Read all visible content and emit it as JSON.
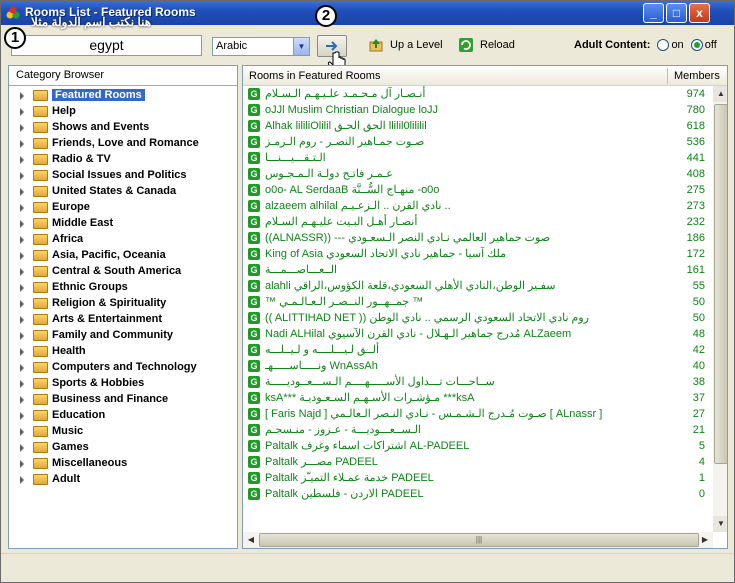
{
  "title": "Rooms List - Featured Rooms",
  "titlebar_buttons": [
    "_",
    "□",
    "x"
  ],
  "annotations": {
    "badge1": "1",
    "badge2": "2",
    "overlay_arabic": "هنا نكتب اسم الدولة مثلا"
  },
  "search": {
    "value": "egypt"
  },
  "language_select": {
    "value": "Arabic"
  },
  "toolbar": {
    "up_level": "Up a Level",
    "reload": "Reload",
    "adult_label": "Adult Content:",
    "on": "on",
    "off": "off",
    "adult_selected": "off"
  },
  "left_pane": {
    "header": "Category Browser",
    "items": [
      "Featured Rooms",
      "Help",
      "Shows and Events",
      "Friends, Love and Romance",
      "Radio & TV",
      "Social Issues and Politics",
      "United States & Canada",
      "Europe",
      "Middle East",
      "Africa",
      "Asia, Pacific, Oceania",
      "Central & South America",
      "Ethnic Groups",
      "Religion & Spirituality",
      "Arts & Entertainment",
      "Family and Community",
      "Health",
      "Computers and Technology",
      "Sports & Hobbies",
      "Business and Finance",
      "Education",
      "Music",
      "Games",
      "Miscellaneous",
      "Adult"
    ],
    "selected": "Featured Rooms"
  },
  "right_pane": {
    "col_rooms": "Rooms in Featured Rooms",
    "col_members": "Members",
    "rows": [
      {
        "name": "أنـصـار آل مـحـمـد علـيـهـم الـسـلام",
        "count": "974"
      },
      {
        "name": "oJJl Muslim Christian Dialogue loJJ",
        "count": "780"
      },
      {
        "name": "Alhak lililiOlilil الحق الحـق llilil0lililil",
        "count": "618"
      },
      {
        "name": "صـوت جمـاهير النصـر - روم الـرمـز",
        "count": "536"
      },
      {
        "name": "الـتـقـــيـــنـــا",
        "count": "441"
      },
      {
        "name": "عـمـر فاتـح دولـة الـمـجـوس",
        "count": "408"
      },
      {
        "name": "o0o- AL SerdaaB منهـاج السُّــنَّة -o0o",
        "count": "275"
      },
      {
        "name": "alzaeem alhilal نادي القرن .. الـزعـيـم ..",
        "count": "273"
      },
      {
        "name": "أنصـار أهـل البـيت عليـهـم السـلام",
        "count": "232"
      },
      {
        "name": "((ALNASSR)) --- صوت جماهير العالمي نـادي النصر الـسعـودي",
        "count": "186"
      },
      {
        "name": "King of Asia ملك آسيا - جماهير نادي الاتحاد السعودي",
        "count": "172"
      },
      {
        "name": "الــعـــاصـــمـــة",
        "count": "161"
      },
      {
        "name": "alahli سفـير الوطن،النادي الأهلي السعودي،قلعة الكؤوس،الراقي",
        "count": "55"
      },
      {
        "name": "™ جمــهــور النــصـر الـعـالـمـي ™",
        "count": "50"
      },
      {
        "name": "(( ALITTIHAD NET )) روم نادي الاتحاد السعودي الرسمي .. نادي الوطن",
        "count": "50"
      },
      {
        "name": "Nadi ALHilal مُدرج جماهير الـهـلال - نادي القرن الآسيوي ALZaeem",
        "count": "48"
      },
      {
        "name": "ألــق لـيـــلــــه و لـيــلـــه",
        "count": "42"
      },
      {
        "name": "ونـــــاســـــهـ WnAssAh",
        "count": "40"
      },
      {
        "name": "ســاحـــات تـــداول الأســـــهــــم الـســـعــوديـــــة",
        "count": "38"
      },
      {
        "name": "ksA*** مـؤشـرات الأسـهـم السـعـوديـة ***ksA",
        "count": "37"
      },
      {
        "name": "[ Faris Najd ] صـوت مُـدرج الـشـمـس - نـادي النـصر الـعالـمي [ ALnassr ]",
        "count": "27"
      },
      {
        "name": "الـســعـــوديـــة - عـزوز - منـسجـم",
        "count": "21"
      },
      {
        "name": "Paltalk اشتراكات اسماء وغرف AL-PADEEL",
        "count": "5"
      },
      {
        "name": "Paltalk مصـــر PADEEL",
        "count": "4"
      },
      {
        "name": "Paltalk خدمة عمـلاء التميـّز PADEEL",
        "count": "1"
      },
      {
        "name": "Paltalk الاردن - فلسطين PADEEL",
        "count": "0"
      }
    ]
  }
}
